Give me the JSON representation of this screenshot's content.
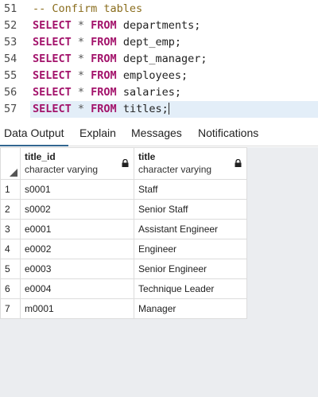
{
  "editor": {
    "lines": [
      {
        "num": "51",
        "parts": [
          {
            "t": "-- Confirm tables",
            "c": "cm"
          }
        ]
      },
      {
        "num": "52",
        "parts": [
          {
            "t": "SELECT",
            "c": "kw"
          },
          {
            "t": " * ",
            "c": "op"
          },
          {
            "t": "FROM",
            "c": "kw"
          },
          {
            "t": " departments;",
            "c": ""
          }
        ]
      },
      {
        "num": "53",
        "parts": [
          {
            "t": "SELECT",
            "c": "kw"
          },
          {
            "t": " * ",
            "c": "op"
          },
          {
            "t": "FROM",
            "c": "kw"
          },
          {
            "t": " dept_emp;",
            "c": ""
          }
        ]
      },
      {
        "num": "54",
        "parts": [
          {
            "t": "SELECT",
            "c": "kw"
          },
          {
            "t": " * ",
            "c": "op"
          },
          {
            "t": "FROM",
            "c": "kw"
          },
          {
            "t": " dept_manager;",
            "c": ""
          }
        ]
      },
      {
        "num": "55",
        "parts": [
          {
            "t": "SELECT",
            "c": "kw"
          },
          {
            "t": " * ",
            "c": "op"
          },
          {
            "t": "FROM",
            "c": "kw"
          },
          {
            "t": " employees;",
            "c": ""
          }
        ]
      },
      {
        "num": "56",
        "parts": [
          {
            "t": "SELECT",
            "c": "kw"
          },
          {
            "t": " * ",
            "c": "op"
          },
          {
            "t": "FROM",
            "c": "kw"
          },
          {
            "t": " salaries;",
            "c": ""
          }
        ]
      },
      {
        "num": "57",
        "parts": [
          {
            "t": "SELECT",
            "c": "kw"
          },
          {
            "t": " * ",
            "c": "op"
          },
          {
            "t": "FROM",
            "c": "kw"
          },
          {
            "t": " titles;",
            "c": ""
          }
        ],
        "active": true
      }
    ]
  },
  "tabs": [
    {
      "label": "Data Output",
      "active": true
    },
    {
      "label": "Explain",
      "active": false
    },
    {
      "label": "Messages",
      "active": false
    },
    {
      "label": "Notifications",
      "active": false
    }
  ],
  "grid": {
    "columns": [
      {
        "name": "title_id",
        "type": "character varying"
      },
      {
        "name": "title",
        "type": "character varying"
      }
    ],
    "rows": [
      {
        "n": "1",
        "cells": [
          "s0001",
          "Staff"
        ]
      },
      {
        "n": "2",
        "cells": [
          "s0002",
          "Senior Staff"
        ]
      },
      {
        "n": "3",
        "cells": [
          "e0001",
          "Assistant Engineer"
        ]
      },
      {
        "n": "4",
        "cells": [
          "e0002",
          "Engineer"
        ]
      },
      {
        "n": "5",
        "cells": [
          "e0003",
          "Senior Engineer"
        ]
      },
      {
        "n": "6",
        "cells": [
          "e0004",
          "Technique Leader"
        ]
      },
      {
        "n": "7",
        "cells": [
          "m0001",
          "Manager"
        ]
      }
    ]
  },
  "colors": {
    "accent": "#326690",
    "keyword": "#a3136b",
    "comment": "#8a6d1d",
    "active_line": "#e3eef8"
  },
  "icons": {
    "column_lock": "lock-icon",
    "corner": "sort-triangle-icon"
  }
}
